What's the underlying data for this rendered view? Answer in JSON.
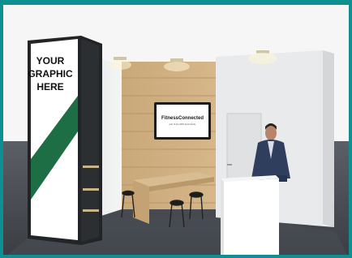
{
  "scene": {
    "kind": "exhibition booth render",
    "frame_color": "#0e8f92",
    "graphic_tower": {
      "line1": "YOUR",
      "line2": "GRAPHIC",
      "line3": "HERE",
      "stripe_color": "#1d6e45"
    },
    "tv_screen": {
      "brand": "FitnessConnected",
      "tagline": "part of the GMS Sport family"
    }
  }
}
